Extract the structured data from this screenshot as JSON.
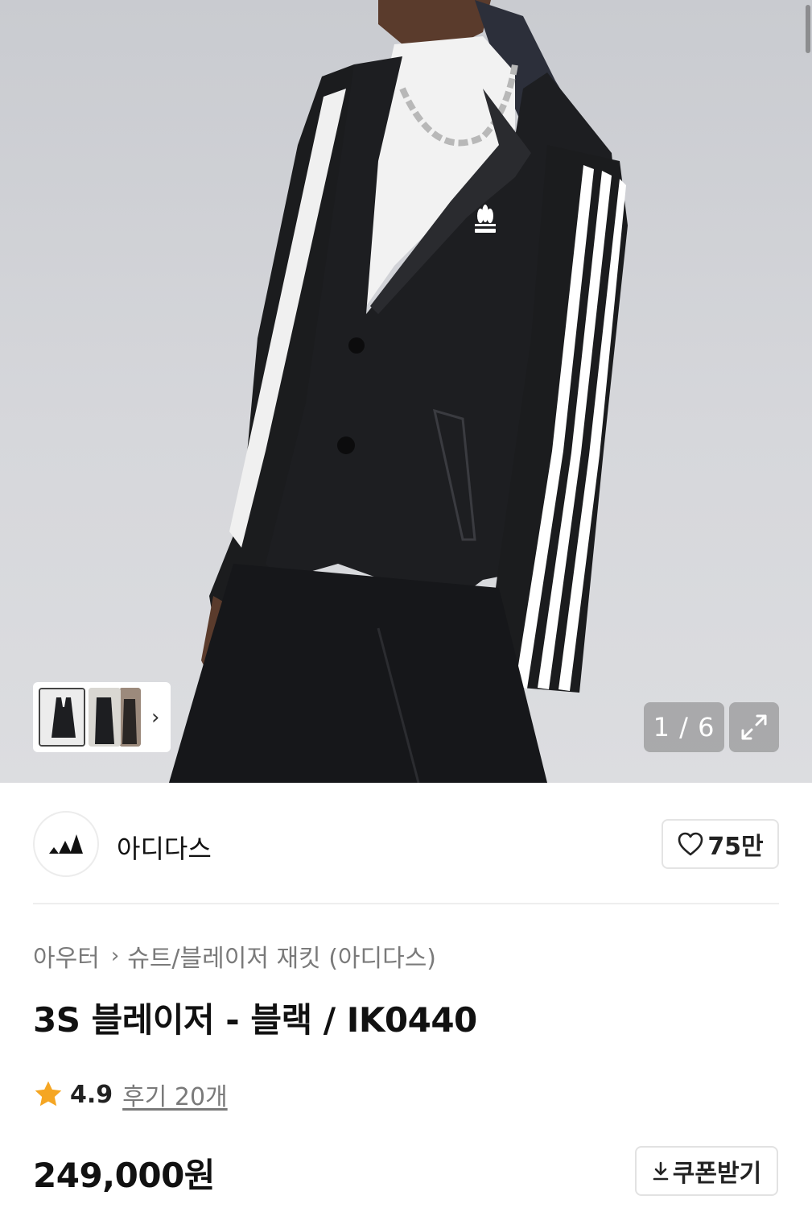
{
  "gallery": {
    "page_indicator": "1 / 6",
    "current_page": 1,
    "total_pages": 6,
    "thumbnail_count": 3,
    "expand_icon": "expand-icon",
    "next_icon": "chevron-right-icon",
    "product_brand_mark": "adidas"
  },
  "brand": {
    "name": "아디다스",
    "logo_icon": "adidas-logo-icon",
    "like_count": "75만",
    "like_icon": "heart-icon"
  },
  "breadcrumb": {
    "category": "아우터",
    "subcategory": "슈트/블레이저 재킷 (아디다스)"
  },
  "product": {
    "title": "3S 블레이저 - 블랙 / IK0440",
    "rating": "4.9",
    "reviews_label": "후기 20개",
    "price": "249,000원",
    "coupon_label": "쿠폰받기"
  },
  "colors": {
    "star": "#f5a623",
    "jacket": "#1b1c1e",
    "stripe": "#ffffff"
  }
}
